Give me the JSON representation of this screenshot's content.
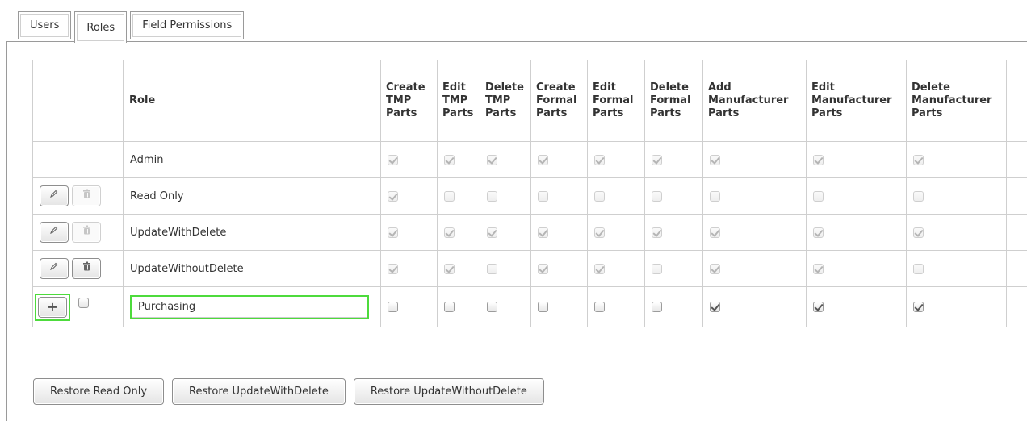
{
  "tabs": [
    {
      "label": "Users",
      "active": false
    },
    {
      "label": "Roles",
      "active": true
    },
    {
      "label": "Field Permissions",
      "active": false
    }
  ],
  "table": {
    "role_header": "Role",
    "permission_headers": [
      [
        "Create",
        "TMP",
        "Parts"
      ],
      [
        "Edit",
        "TMP",
        "Parts"
      ],
      [
        "Delete",
        "TMP",
        "Parts"
      ],
      [
        "Create",
        "Formal",
        "Parts"
      ],
      [
        "Edit",
        "Formal",
        "Parts"
      ],
      [
        "Delete",
        "Formal",
        "Parts"
      ],
      [
        "Add",
        "Manufacturer",
        "Parts"
      ],
      [
        "Edit",
        "Manufacturer",
        "Parts"
      ],
      [
        "Delete",
        "Manufacturer",
        "Parts"
      ]
    ],
    "rows": [
      {
        "name": "Admin",
        "edit_button": "none",
        "delete_button": "none",
        "perms": [
          true,
          true,
          true,
          true,
          true,
          true,
          true,
          true,
          true
        ]
      },
      {
        "name": "Read Only",
        "edit_button": "enabled",
        "delete_button": "disabled",
        "perms": [
          true,
          false,
          false,
          false,
          false,
          false,
          false,
          false,
          false
        ]
      },
      {
        "name": "UpdateWithDelete",
        "edit_button": "enabled",
        "delete_button": "disabled",
        "perms": [
          true,
          true,
          true,
          true,
          true,
          true,
          true,
          true,
          true
        ]
      },
      {
        "name": "UpdateWithoutDelete",
        "edit_button": "enabled",
        "delete_button": "enabled",
        "perms": [
          true,
          true,
          false,
          true,
          true,
          false,
          true,
          true,
          false
        ]
      }
    ],
    "new_row": {
      "name_value": "Purchasing",
      "select_checked": false,
      "perms": [
        false,
        false,
        false,
        false,
        false,
        false,
        true,
        true,
        true
      ]
    }
  },
  "restore_buttons": [
    "Restore Read Only",
    "Restore UpdateWithDelete",
    "Restore UpdateWithoutDelete"
  ],
  "icons": {
    "edit": "pencil-icon",
    "delete": "trash-icon",
    "add": "plus-icon"
  },
  "colors": {
    "highlight": "#4ddb3c",
    "border": "#cfcfcf"
  }
}
